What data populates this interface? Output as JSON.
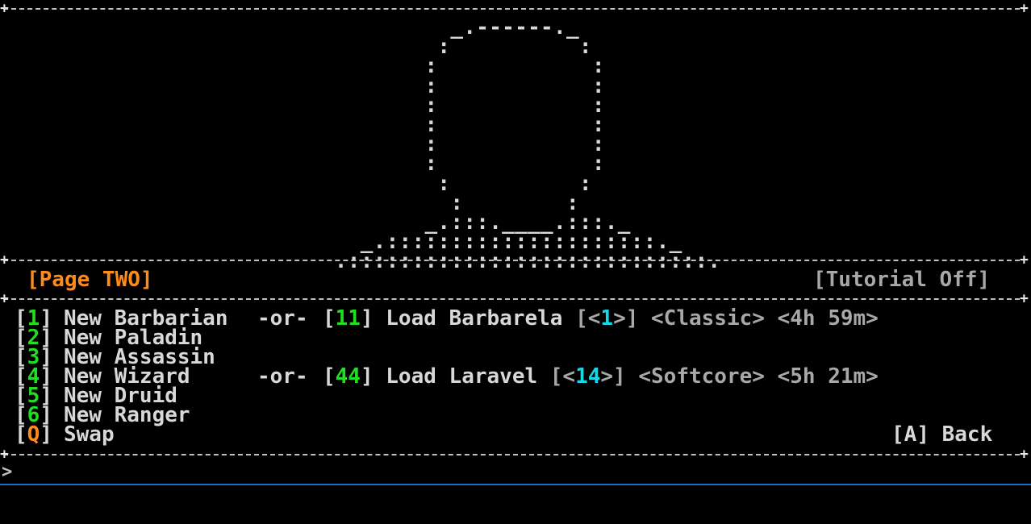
{
  "art": {
    "lines": [
      "                                   _.------._",
      "                                  :          :",
      "                                 :            :",
      "                                 :            :",
      "                                 :            :",
      "                                 :            :",
      "                                 :            :",
      "                                 :            :",
      "                                  :          :",
      "                                   :        :",
      "                                 _.:::.____.:::._",
      "                            _.:::::::::::::::::::::._",
      "                          .::::::::::::::::::::::::::::."
    ]
  },
  "header": {
    "page_label": "[Page TWO]",
    "tutorial_label": "[Tutorial Off]"
  },
  "menu": {
    "options": [
      {
        "key": "1",
        "label": "New Barbarian"
      },
      {
        "key": "2",
        "label": "New Paladin"
      },
      {
        "key": "3",
        "label": "New Assassin"
      },
      {
        "key": "4",
        "label": "New Wizard"
      },
      {
        "key": "5",
        "label": "New Druid"
      },
      {
        "key": "6",
        "label": "New Ranger"
      },
      {
        "key": "Q",
        "label": "Swap"
      }
    ],
    "or_text": "-or-",
    "saves": [
      {
        "key": "11",
        "label": "Load Barbarela",
        "level": "1",
        "mode": "<Classic>",
        "time": "<4h 59m>"
      },
      {
        "key": "44",
        "label": "Load Laravel",
        "level": "14",
        "mode": "<Softcore>",
        "time": "<5h 21m>"
      }
    ],
    "back": {
      "key": "A",
      "label": "Back"
    }
  },
  "prompt": ">"
}
